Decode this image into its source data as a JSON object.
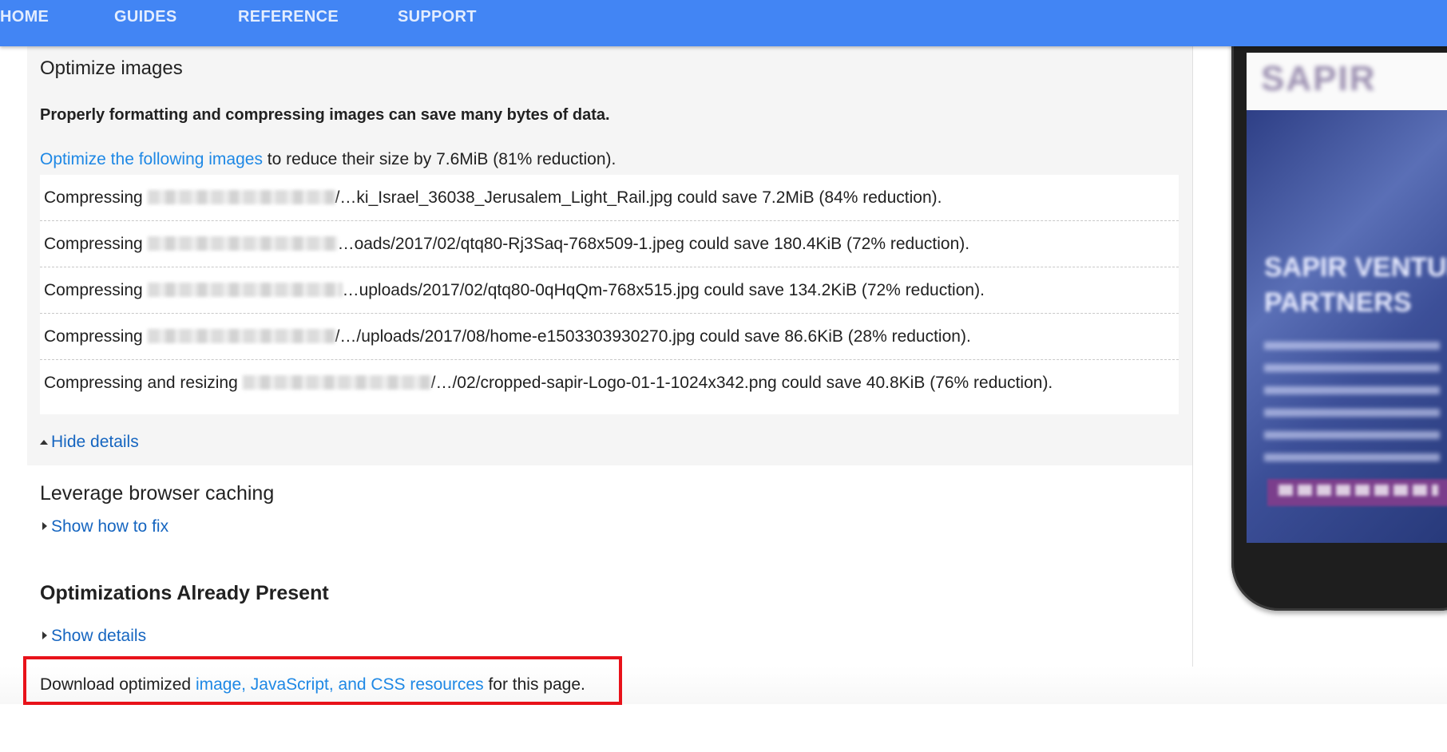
{
  "nav": {
    "items": [
      {
        "label": "HOME"
      },
      {
        "label": "GUIDES"
      },
      {
        "label": "REFERENCE"
      },
      {
        "label": "SUPPORT"
      }
    ]
  },
  "colors": {
    "nav_bg": "#4285f4",
    "link": "#1e88e5",
    "highlight": "#e8121a",
    "panel_bg": "#f5f5f5"
  },
  "optimize": {
    "title": "Optimize images",
    "summary": "Properly formatting and compressing images can save many bytes of data.",
    "desc_link": "Optimize the following images",
    "desc_rest": " to reduce their size by 7.6MiB (81% reduction).",
    "rows": [
      {
        "prefix": "Compressing ",
        "suffix": "/…ki_Israel_36038_Jerusalem_Light_Rail.jpg could save 7.2MiB (84% reduction)."
      },
      {
        "prefix": "Compressing ",
        "suffix": "…oads/2017/02/qtq80-Rj3Saq-768x509-1.jpeg could save 180.4KiB (72% reduction)."
      },
      {
        "prefix": "Compressing ",
        "suffix": "…uploads/2017/02/qtq80-0qHqQm-768x515.jpg could save 134.2KiB (72% reduction)."
      },
      {
        "prefix": "Compressing ",
        "suffix": "/…/uploads/2017/08/home-e1503303930270.jpg could save 86.6KiB (28% reduction)."
      },
      {
        "prefix": "Compressing and resizing ",
        "suffix": "/…/02/cropped-sapir-Logo-01-1-1024x342.png could save 40.8KiB (76% reduction)."
      }
    ],
    "hide_details": "Hide details"
  },
  "caching": {
    "title": "Leverage browser caching",
    "show_how": "Show how to fix"
  },
  "present": {
    "title": "Optimizations Already Present",
    "show_details": "Show details"
  },
  "download": {
    "prefix": "Download optimized ",
    "link": "image, JavaScript, and CSS resources",
    "suffix": " for this page."
  },
  "phone": {
    "logo": "SAPIR",
    "hero_title_1": "SAPIR VENTURE",
    "hero_title_2": "PARTNERS"
  }
}
